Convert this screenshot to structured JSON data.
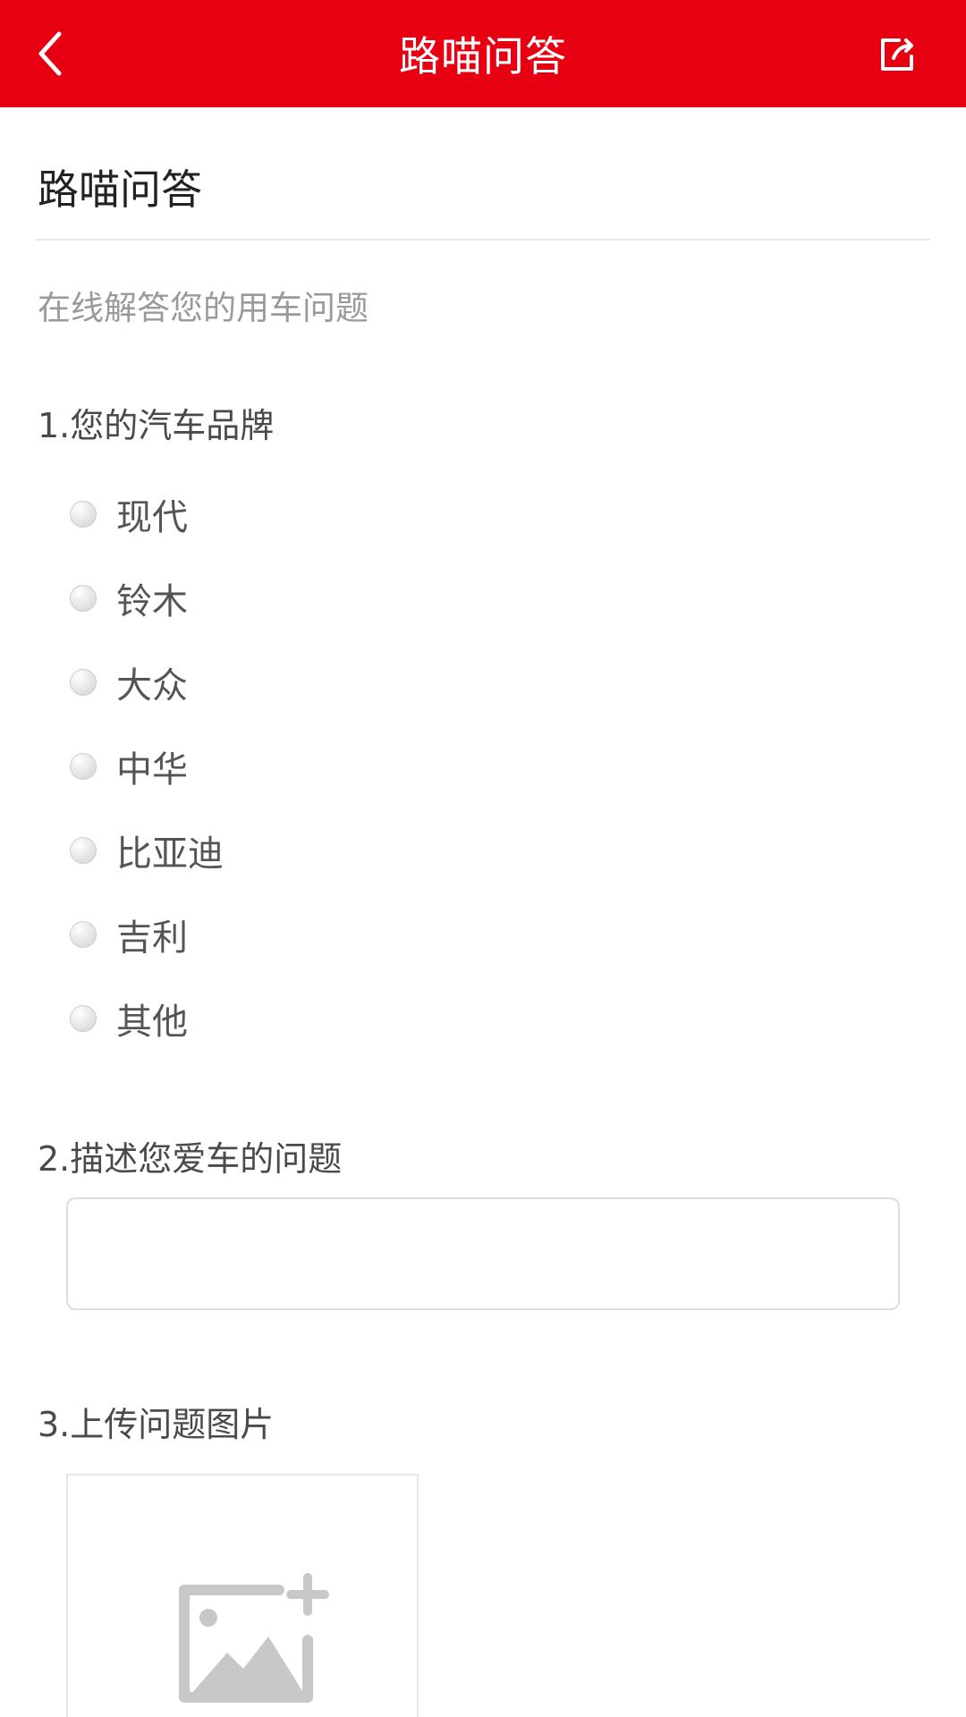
{
  "header": {
    "title": "路喵问答",
    "back_icon": "chevron-left-icon",
    "share_icon": "share-icon",
    "bg_color": "#E60012"
  },
  "page": {
    "title": "路喵问答",
    "subtitle": "在线解答您的用车问题"
  },
  "questions": {
    "q1": {
      "label": "1.您的汽车品牌",
      "options": [
        "现代",
        "铃木",
        "大众",
        "中华",
        "比亚迪",
        "吉利",
        "其他"
      ]
    },
    "q2": {
      "label": "2.描述您爱车的问题",
      "value": "",
      "placeholder": ""
    },
    "q3": {
      "label": "3.上传问题图片",
      "upload_icon": "add-image-icon"
    }
  }
}
